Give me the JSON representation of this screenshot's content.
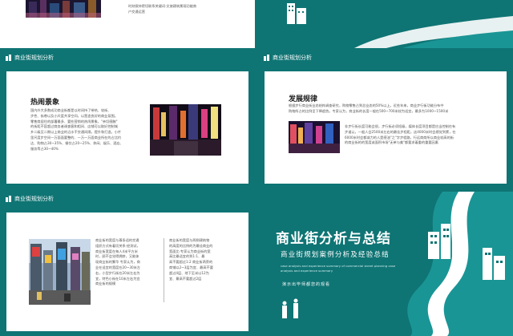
{
  "colors": {
    "teal": "#0f7474",
    "teal_light": "#1a9595",
    "white": "#ffffff"
  },
  "icons": {
    "header_icon": "city-building-icon"
  },
  "slide_top_left": {
    "text_lines": [
      "时刻保持密切联系关键词·文旅建筑景观功能商",
      "户交通运营"
    ]
  },
  "slide_mid_left": {
    "header": "商业街规划分析",
    "title": "热闹景象",
    "paragraph": [
      "国内外大多数成功商业街都是以时间持了带热、较街、",
      "步性、街巷以及小尺度共享空间，以营造良好的商业氛围。",
      "零售商居住的部署最多、要些营销的热闹景象，\"亲切感触\"",
      "的街距不容超过商务者调查客和相间、店铺可以取好控制城",
      "乡二级至二期以上商业的沿水干交通间隔，提升和打造。小片",
      "里尺度步空间一万面面要整的、一万一万面商业所在的占比约",
      "达、购物占30~35%、餐饮占20~25%、休闲、娱乐、酒店、",
      "服务等占30~40%"
    ]
  },
  "slide_mid_right": {
    "header": "商业街规划分析",
    "title": "发展规律",
    "paragraph_top": [
      "根据步行商业街业态结构调查研究，购物零售占到总业态的50%以上，近些年来，商业步行街功能分布中",
      "购物所占的比例呈下降趋势。专家认为，商业街的长度一般在500~700米较为适宜，最多为1000~1500米"
    ],
    "paragraph_side": [
      "非步行街长度可能会很，步行街必须短级，媒体长度项目都是应当控制在有",
      "步道认，一般人会2500米左右的最佳步程距，这4000米时会感觉到累，在",
      "6000米时会都减力的人是感油\"之\"字步程路，行远商商所以商业较高的街",
      "的商业街的的宽度或面积市场\"无单与美\"都要求着重的重要因素"
    ]
  },
  "slide_bottom_left": {
    "header": "商业街规划分析",
    "col1": [
      "商业街的宽度与尊条适的交通",
      "组织方式有着切关系·经测试，",
      "商业街宽度在每人4米平方米",
      "时，顾不会觉得拥挤，又能体",
      "现商业街的繁华 专家认为，商",
      "业在适宜的宽度在20~30米左",
      "右，小型步行街在20米左右为",
      "宜，特色小街在10米左右为宜",
      "商业街的规模"
    ],
    "col2": [
      "商业街的宽度与两侧建筑物",
      "的高度的比例的为最佳商业的",
      "宽面比·专家认为商业街的宽",
      "高比最适宜的到1:1、最",
      "高不要超过1:2 商业街两旁的",
      "商铺以2~3层为宜、最高不要",
      "超过4层、地下至米以12为",
      "宜、最高不要超过2层"
    ]
  },
  "slide_title": {
    "title": "商业街分析与总结",
    "subtitle": "商业街规划案例分析及经验总结",
    "en_lines": [
      "case analysis and experience summary of commercial street planning case",
      "analysis and experience summary"
    ],
    "presenter": "演示出毕师都您的观看"
  }
}
